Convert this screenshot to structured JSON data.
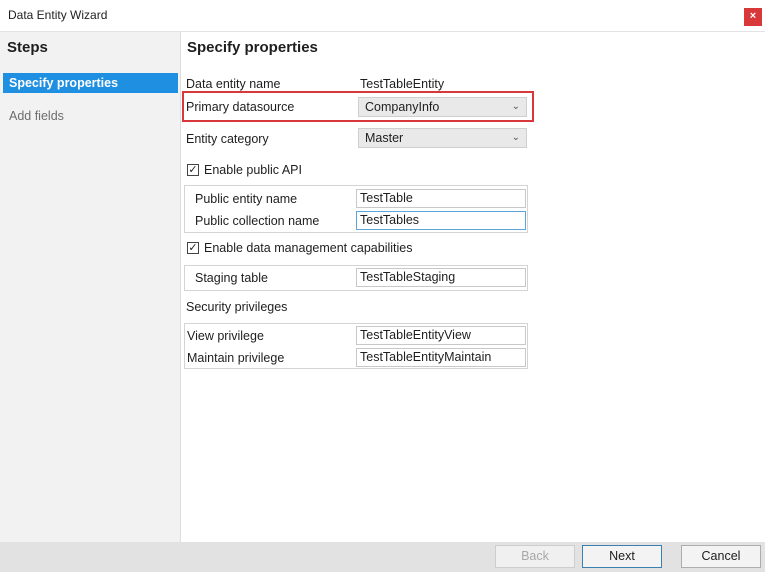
{
  "window": {
    "title": "Data Entity Wizard",
    "close_label": "×"
  },
  "sidebar": {
    "heading": "Steps",
    "items": [
      {
        "label": "Specify properties",
        "active": true
      },
      {
        "label": "Add fields",
        "active": false
      }
    ]
  },
  "main": {
    "heading": "Specify properties",
    "entity_name": {
      "label": "Data entity name",
      "value": "TestTableEntity"
    },
    "primary_datasource": {
      "label": "Primary datasource",
      "value": "CompanyInfo"
    },
    "entity_category": {
      "label": "Entity category",
      "value": "Master"
    },
    "public_api": {
      "checkbox_label": "Enable public API",
      "checked": true,
      "public_entity_name": {
        "label": "Public entity name",
        "value": "TestTable"
      },
      "public_collection_name": {
        "label": "Public collection name",
        "value": "TestTables"
      }
    },
    "data_management": {
      "checkbox_label": "Enable data management capabilities",
      "checked": true,
      "staging_table": {
        "label": "Staging table",
        "value": "TestTableStaging"
      }
    },
    "security": {
      "heading": "Security privileges",
      "view_privilege": {
        "label": "View privilege",
        "value": "TestTableEntityView"
      },
      "maintain_privilege": {
        "label": "Maintain privilege",
        "value": "TestTableEntityMaintain"
      }
    }
  },
  "footer": {
    "back_label": "Back",
    "next_label": "Next",
    "cancel_label": "Cancel"
  },
  "colors": {
    "accent": "#1e8fe1",
    "highlight_border": "#d9383a",
    "close_button": "#d9383a"
  },
  "icons": {
    "checkmark": "check-icon",
    "dropdown": "chevron-down-icon",
    "close": "close-icon"
  }
}
